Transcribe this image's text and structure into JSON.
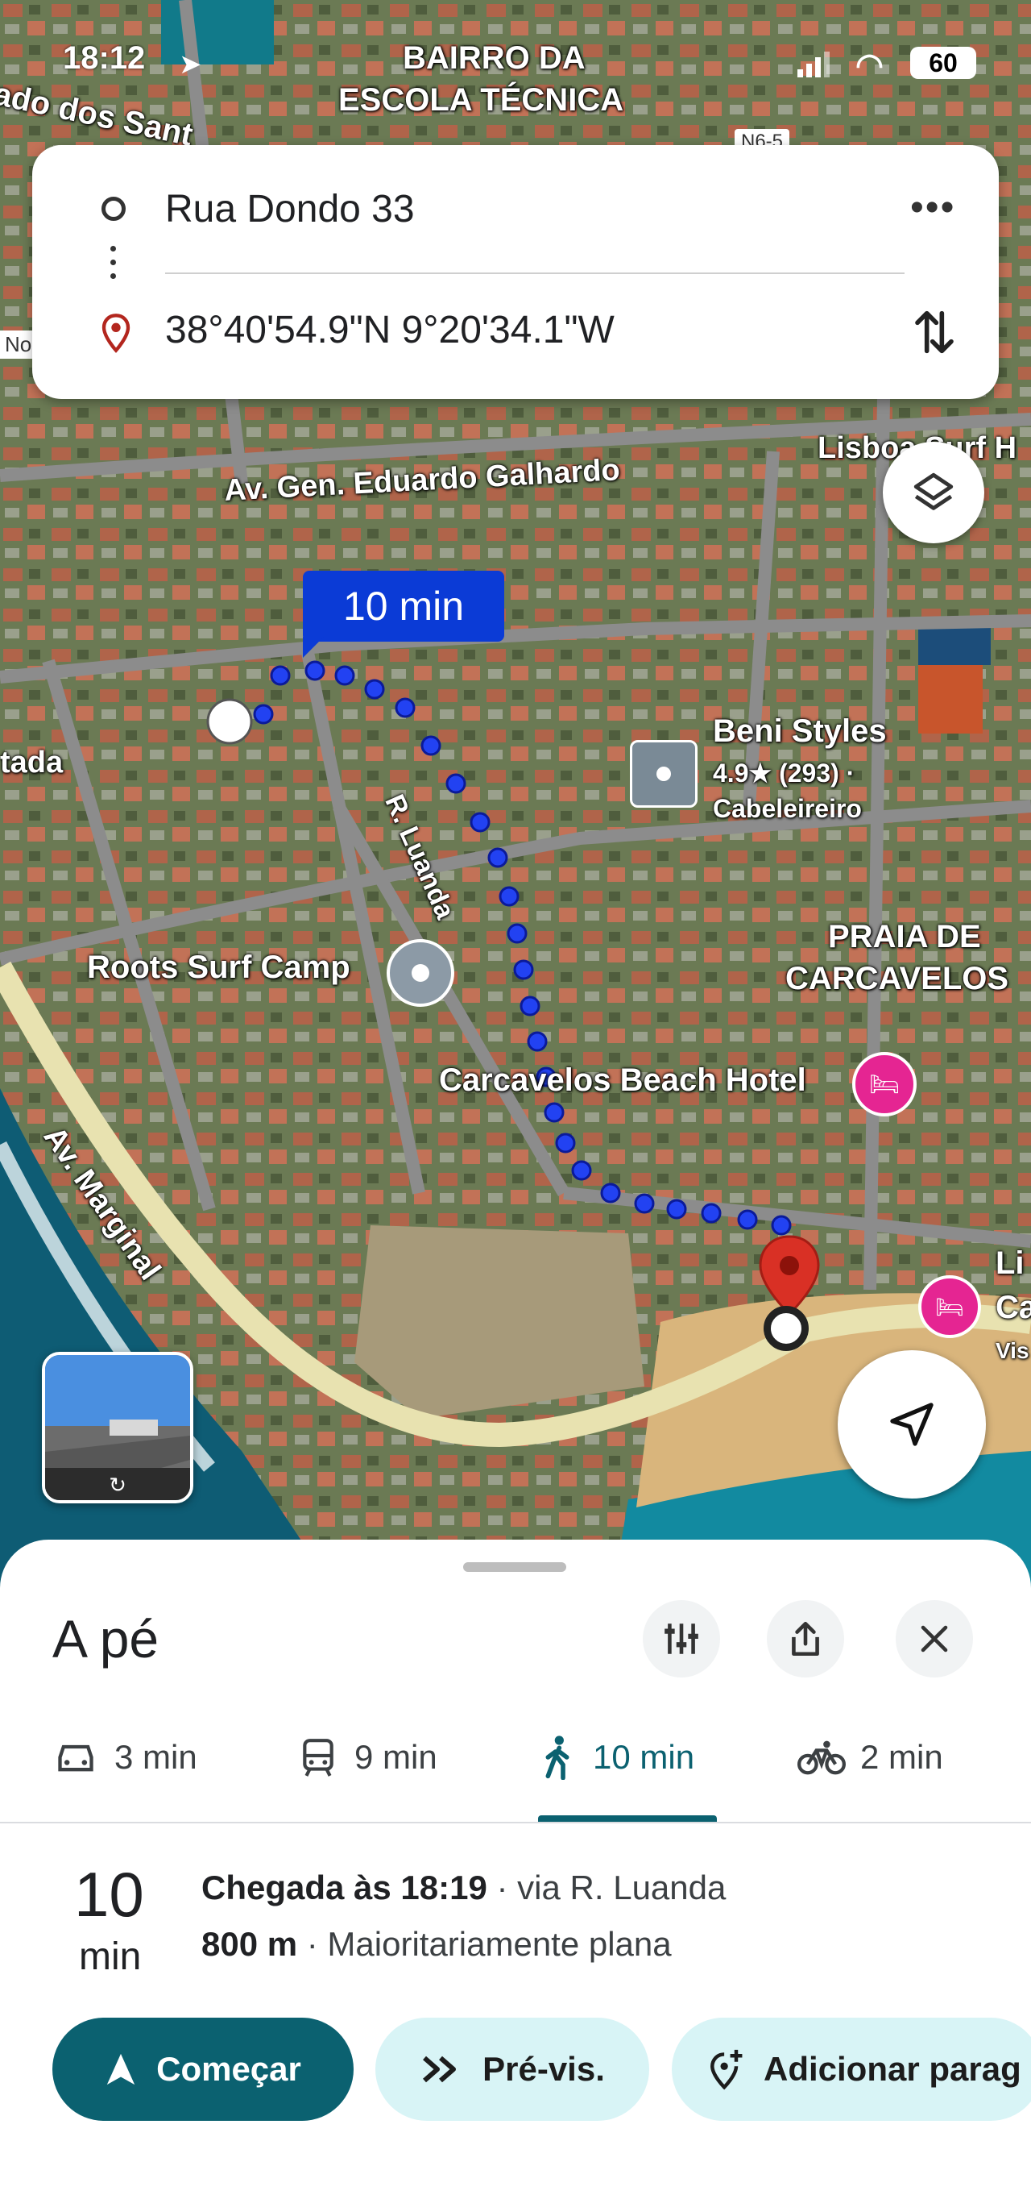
{
  "status_bar": {
    "time": "18:12",
    "battery": "60"
  },
  "map_labels": {
    "district": "BAIRRO DA",
    "district2": "ESCOLA TÉCNICA",
    "top_left_road": "ado dos Sant",
    "road_code": "N6-5",
    "edge_no": "No",
    "avenue": "Av. Gen. Eduardo Galhardo",
    "surf_edge": "Lisboa Surf H",
    "eta": "10 min",
    "street": "R. Luanda",
    "left_edge": "tada",
    "poi1_name": "Beni Styles",
    "poi1_rating": "4.9★ (293) ·",
    "poi1_type": "Cabeleireiro",
    "poi2_name": "Roots Surf Camp",
    "beach1": "PRAIA DE",
    "beach2": "CARCAVELOS",
    "hotel": "Carcavelos Beach Hotel",
    "marginal": "Av. Marginal",
    "edge_li": "Li",
    "edge_ca": "Ca",
    "edge_vis": "Vis"
  },
  "route_card": {
    "origin": "Rua Dondo 33",
    "destination": "38°40'54.9\"N 9°20'34.1\"W"
  },
  "sheet": {
    "title": "A pé",
    "modes": [
      {
        "icon": "car-icon",
        "label": "3 min"
      },
      {
        "icon": "transit-icon",
        "label": "9 min"
      },
      {
        "icon": "walk-icon",
        "label": "10 min",
        "selected": true
      },
      {
        "icon": "bike-icon",
        "label": "2 min"
      }
    ],
    "duration_value": "10",
    "duration_unit": "min",
    "arrival": "Chegada às 18:19",
    "via": " · via R. Luanda",
    "distance": "800 m",
    "terrain": " · Maioritariamente plana",
    "buttons": {
      "start": "Começar",
      "preview": "Pré-vis.",
      "add_stop": "Adicionar parag"
    }
  },
  "colors": {
    "accent": "#0b6170",
    "route": "#1a4fff",
    "pin": "#d93025",
    "hotel": "#e52592"
  }
}
